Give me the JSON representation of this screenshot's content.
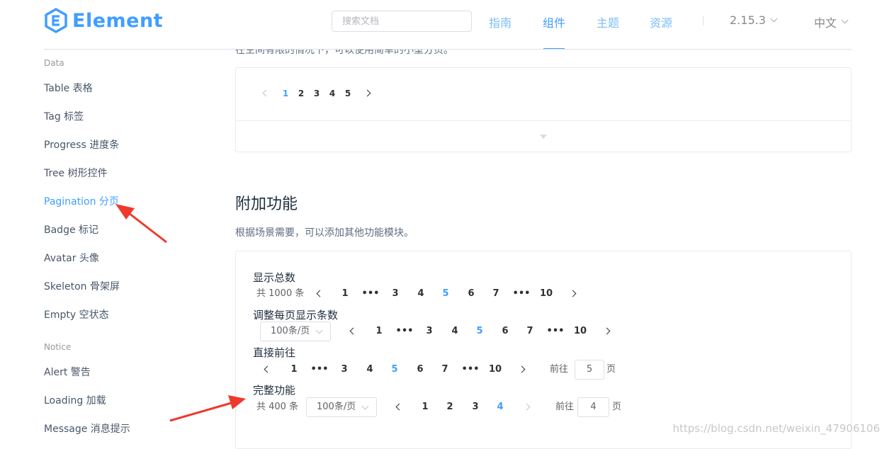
{
  "header": {
    "logo_text": "Element",
    "search_placeholder": "搜索文档",
    "nav": [
      {
        "label": "指南",
        "active": false
      },
      {
        "label": "组件",
        "active": true
      },
      {
        "label": "主题",
        "active": false
      },
      {
        "label": "资源",
        "active": false
      }
    ],
    "version": "2.15.3",
    "language": "中文"
  },
  "sidebar": {
    "groups": [
      {
        "title": "Data",
        "items": [
          "Table 表格",
          "Tag 标签",
          "Progress 进度条",
          "Tree 树形控件",
          "Pagination 分页",
          "Badge 标记",
          "Avatar 头像",
          "Skeleton 骨架屏",
          "Empty 空状态"
        ]
      },
      {
        "title": "Notice",
        "items": [
          "Alert 警告",
          "Loading 加载",
          "Message 消息提示"
        ]
      }
    ],
    "active_item": "Pagination 分页"
  },
  "content": {
    "cut_text": "在空间有限的情况下，可以使用简单的小型分页。",
    "small_pager": {
      "pages": [
        "1",
        "2",
        "3",
        "4",
        "5"
      ],
      "current": "1"
    },
    "section_title": "附加功能",
    "section_desc": "根据场景需要，可以添加其他功能模块。",
    "blocks": [
      {
        "title": "显示总数",
        "total_text": "共 1000 条",
        "pages": [
          "1",
          "•••",
          "3",
          "4",
          "5",
          "6",
          "7",
          "•••",
          "10"
        ],
        "current": "5"
      },
      {
        "title": "调整每页显示条数",
        "size_select": "100条/页",
        "pages": [
          "1",
          "•••",
          "3",
          "4",
          "5",
          "6",
          "7",
          "•••",
          "10"
        ],
        "current": "5"
      },
      {
        "title": "直接前往",
        "pages": [
          "1",
          "•••",
          "3",
          "4",
          "5",
          "6",
          "7",
          "•••",
          "10"
        ],
        "current": "5",
        "jumper_prefix": "前往",
        "jumper_value": "5",
        "jumper_suffix": "页"
      },
      {
        "title": "完整功能",
        "total_text": "共 400 条",
        "size_select": "100条/页",
        "pages": [
          "1",
          "2",
          "3",
          "4"
        ],
        "current": "4",
        "jumper_prefix": "前往",
        "jumper_value": "4",
        "jumper_suffix": "页"
      }
    ]
  },
  "watermark": "https://blog.csdn.net/weixin_47906106",
  "colors": {
    "primary": "#409eff",
    "annotation_arrow": "#ee3a2c"
  }
}
